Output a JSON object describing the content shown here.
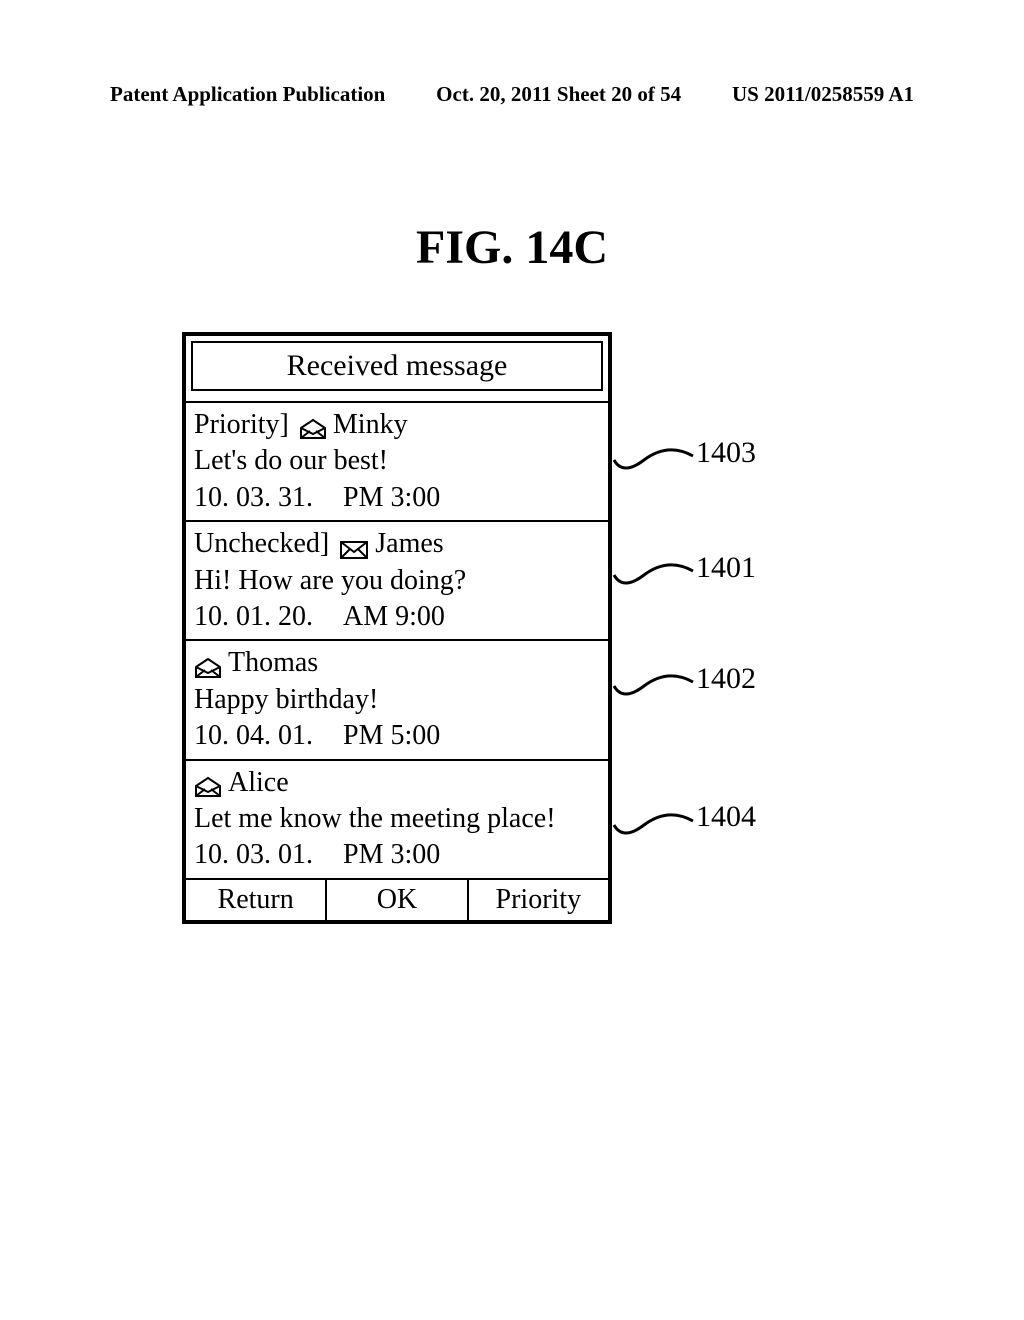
{
  "header": {
    "left": "Patent Application Publication",
    "middle": "Oct. 20, 2011  Sheet 20 of 54",
    "right": "US 2011/0258559 A1"
  },
  "figure_label": "FIG. 14C",
  "screen": {
    "title": "Received message",
    "messages": [
      {
        "prefix": "Priority]",
        "icon": "open",
        "sender": "Minky",
        "body": "Let's do our best!",
        "date": "10. 03. 31.",
        "time": "PM  3:00",
        "ref": "1403"
      },
      {
        "prefix": "Unchecked]",
        "icon": "closed",
        "sender": "James",
        "body": "Hi! How are you doing?",
        "date": "10. 01. 20.",
        "time": "AM  9:00",
        "ref": "1401"
      },
      {
        "prefix": "",
        "icon": "open",
        "sender": "Thomas",
        "body": "Happy birthday!",
        "date": "10. 04. 01.",
        "time": "PM  5:00",
        "ref": "1402"
      },
      {
        "prefix": "",
        "icon": "open",
        "sender": "Alice",
        "body": "Let me know the meeting place!",
        "date": "10. 03. 01.",
        "time": "PM  3:00",
        "ref": "1404"
      }
    ],
    "buttons": {
      "left": "Return",
      "center": "OK",
      "right": "Priority"
    }
  }
}
